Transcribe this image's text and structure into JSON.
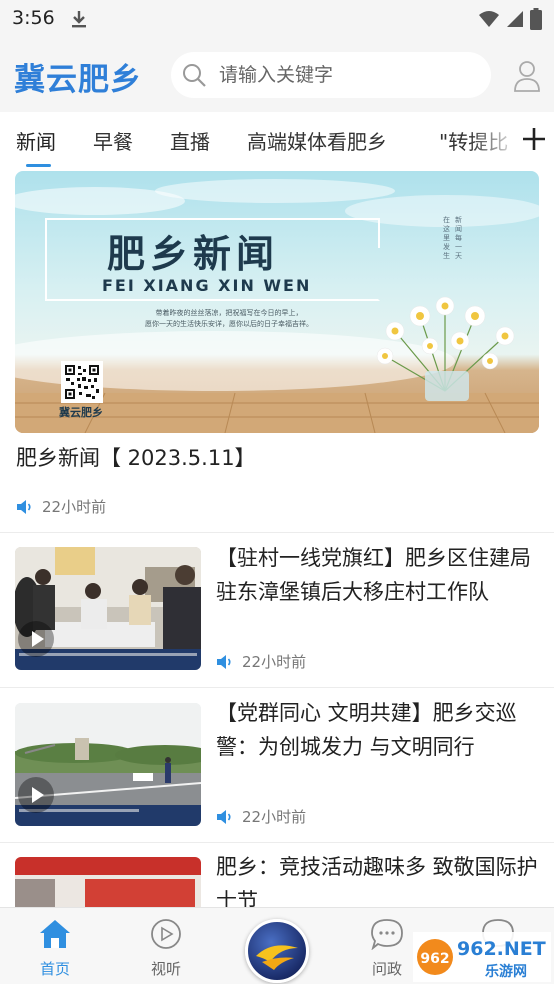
{
  "status_bar": {
    "time": "3:56"
  },
  "header": {
    "logo": "冀云肥乡",
    "search_placeholder": "请输入关键字"
  },
  "tabs": [
    {
      "label": "新闻",
      "active": true
    },
    {
      "label": "早餐"
    },
    {
      "label": "直播"
    },
    {
      "label": "高端媒体看肥乡"
    },
    {
      "label": "\"转提比"
    }
  ],
  "hero": {
    "banner_title": "肥乡新闻",
    "banner_subtitle": "FEI XIANG XIN WEN",
    "banner_small_line1": "带着昨夜的丝丝落凉，把祝福写在今日的早上，",
    "banner_small_line2": "愿你一天的生活快乐安详，愿你以后的日子幸福吉祥。",
    "banner_qr_label": "冀云肥乡",
    "banner_vertical": [
      "新闻每一天",
      "在这里发生"
    ],
    "caption": "肥乡新闻【 2023.5.11】",
    "time": "22小时前"
  },
  "news_items": [
    {
      "title": "【驻村一线党旗红】肥乡区住建局驻东漳堡镇后大移庄村工作队",
      "time": "22小时前",
      "video": true
    },
    {
      "title": "【党群同心 文明共建】肥乡交巡警：为创城发力 与文明同行",
      "time": "22小时前",
      "video": true
    },
    {
      "title": "肥乡：竞技活动趣味多 致敬国际护士节",
      "time": ""
    }
  ],
  "bottom_nav": [
    {
      "label": "首页",
      "icon": "home-icon",
      "active": true
    },
    {
      "label": "视听",
      "icon": "play-circle-icon"
    },
    {
      "label": "问政",
      "icon": "chat-bubble-icon"
    },
    {
      "label": "",
      "icon": "heart-bubble-icon"
    }
  ],
  "watermark": "962.NET 乐游网",
  "colors": {
    "accent": "#2f8fe0",
    "logo": "#2f7fd8",
    "background_header": "#f5f5f5"
  }
}
